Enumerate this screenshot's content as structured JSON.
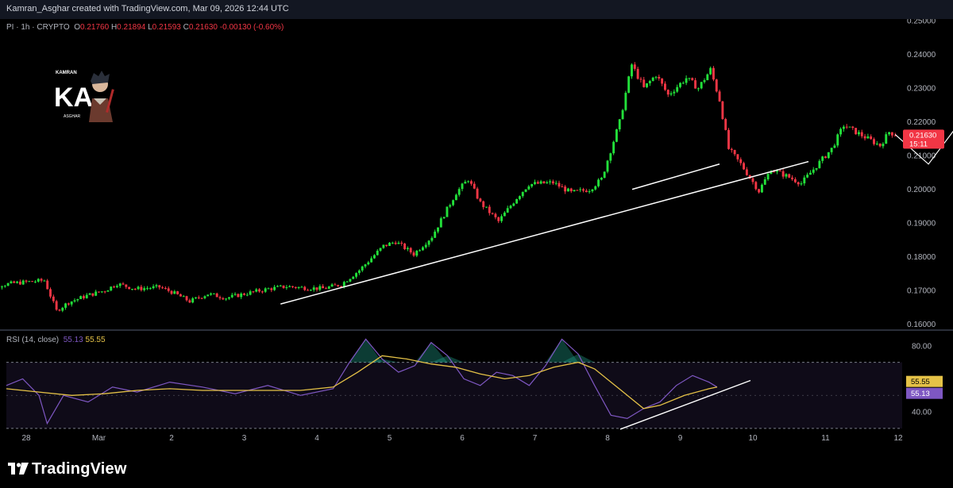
{
  "header": {
    "text": "Kamran_Asghar created with TradingView.com, Mar 09, 2026 12:44 UTC"
  },
  "legend": {
    "symbol": "PI · 1h · CRYPTO",
    "o_label": "O",
    "o_value": "0.21760",
    "h_label": "H",
    "h_value": "0.21894",
    "l_label": "L",
    "l_value": "0.21593",
    "c_label": "C",
    "c_value": "0.21630",
    "change": "-0.00130 (-0.60%)"
  },
  "rsi_legend": {
    "label": "RSI (14, close)",
    "rsi_value": "55.13",
    "ma_value": "55.55"
  },
  "logo": {
    "text": "TradingView"
  },
  "watermark": {
    "top_text": "KAMRAN",
    "mark": "KA",
    "bottom_text": "ASGHAR"
  },
  "colors": {
    "up": "#22e03a",
    "down": "#f23645",
    "rsi": "#7e57c2",
    "rsi_ma": "#e5c247",
    "background": "#000000",
    "drawing": "#ffffff",
    "price_tag": "#f23645"
  },
  "chart_data": [
    {
      "type": "candlestick",
      "title": "PI · 1h · CRYPTO",
      "ylim": [
        0.1585,
        0.2505
      ],
      "yticks": [
        "0.16000",
        "0.17000",
        "0.18000",
        "0.19000",
        "0.20000",
        "0.21000",
        "0.22000",
        "0.23000",
        "0.24000",
        "0.25000"
      ],
      "x_tick_labels": [
        "28",
        "Mar",
        "2",
        "3",
        "4",
        "5",
        "6",
        "7",
        "8",
        "9",
        "10",
        "11",
        "12"
      ],
      "x_tick_dates": [
        "2026-02-28",
        "2026-03-01",
        "2026-03-02",
        "2026-03-03",
        "2026-03-04",
        "2026-03-05",
        "2026-03-06",
        "2026-03-07",
        "2026-03-08",
        "2026-03-09",
        "2026-03-10",
        "2026-03-11",
        "2026-03-12"
      ],
      "current_price": {
        "value": "0.21630",
        "countdown": "15:11"
      },
      "close_path": [
        [
          "2026-02-27 08:00",
          0.1706
        ],
        [
          "2026-02-27 20:00",
          0.1722
        ],
        [
          "2026-02-28 06:00",
          0.173
        ],
        [
          "2026-02-28 10:00",
          0.164
        ],
        [
          "2026-02-28 14:00",
          0.1665
        ],
        [
          "2026-02-28 20:00",
          0.1685
        ],
        [
          "2026-03-01 02:00",
          0.17
        ],
        [
          "2026-03-01 06:00",
          0.172
        ],
        [
          "2026-03-01 12:00",
          0.1705
        ],
        [
          "2026-03-01 20:00",
          0.171
        ],
        [
          "2026-03-02 00:00",
          0.1696
        ],
        [
          "2026-03-02 06:00",
          0.1668
        ],
        [
          "2026-03-02 12:00",
          0.169
        ],
        [
          "2026-03-02 18:00",
          0.1678
        ],
        [
          "2026-03-03 00:00",
          0.169
        ],
        [
          "2026-03-03 08:00",
          0.1705
        ],
        [
          "2026-03-03 14:00",
          0.1712
        ],
        [
          "2026-03-03 20:00",
          0.1708
        ],
        [
          "2026-03-04 02:00",
          0.1706
        ],
        [
          "2026-03-04 08:00",
          0.1718
        ],
        [
          "2026-03-04 14:00",
          0.176
        ],
        [
          "2026-03-04 22:00",
          0.1832
        ],
        [
          "2026-03-05 02:00",
          0.1845
        ],
        [
          "2026-03-05 08:00",
          0.1808
        ],
        [
          "2026-03-05 14:00",
          0.186
        ],
        [
          "2026-03-05 22:00",
          0.199
        ],
        [
          "2026-03-06 02:00",
          0.203
        ],
        [
          "2026-03-06 06:00",
          0.196
        ],
        [
          "2026-03-06 12:00",
          0.1905
        ],
        [
          "2026-03-06 18:00",
          0.1975
        ],
        [
          "2026-03-06 22:00",
          0.2015
        ],
        [
          "2026-03-07 06:00",
          0.202
        ],
        [
          "2026-03-07 12:00",
          0.199
        ],
        [
          "2026-03-07 18:00",
          0.2
        ],
        [
          "2026-03-07 22:00",
          0.203
        ],
        [
          "2026-03-08 04:00",
          0.22
        ],
        [
          "2026-03-08 08:00",
          0.237
        ],
        [
          "2026-03-08 12:00",
          0.23
        ],
        [
          "2026-03-08 16:00",
          0.234
        ],
        [
          "2026-03-08 20:00",
          0.228
        ],
        [
          "2026-03-09 02:00",
          0.233
        ],
        [
          "2026-03-09 06:00",
          0.23
        ],
        [
          "2026-03-09 10:00",
          0.2355
        ],
        [
          "2026-03-09 13:00",
          0.2265
        ],
        [
          "2026-03-09 16:00",
          0.212
        ],
        [
          "2026-03-09 20:00",
          0.2075
        ],
        [
          "2026-03-10 02:00",
          0.1995
        ],
        [
          "2026-03-10 06:00",
          0.206
        ],
        [
          "2026-03-10 11:00",
          0.204
        ],
        [
          "2026-03-10 16:00",
          0.2018
        ],
        [
          "2026-03-10 22:00",
          0.208
        ],
        [
          "2026-03-11 02:00",
          0.212
        ],
        [
          "2026-03-11 06:00",
          0.219
        ],
        [
          "2026-03-11 10:00",
          0.217
        ],
        [
          "2026-03-11 14:00",
          0.215
        ],
        [
          "2026-03-11 18:00",
          0.213
        ],
        [
          "2026-03-11 21:00",
          0.217
        ],
        [
          "2026-03-11 23:00",
          0.2163
        ]
      ],
      "annotations": {
        "trendline": [
          [
            "2026-03-03 12:00",
            0.166
          ],
          [
            "2026-03-11 14:00",
            0.213
          ]
        ],
        "projection_path": [
          [
            "2026-03-11 23:00",
            0.2163
          ],
          [
            "2026-03-12 10:00",
            0.2075
          ],
          [
            "2026-03-12 23:00",
            0.223
          ],
          [
            "2026-03-13 10:00",
            0.2105
          ],
          [
            "2026-03-14 00:00",
            0.2365
          ]
        ]
      }
    },
    {
      "type": "line",
      "title": "RSI (14, close)",
      "ylim": [
        29,
        89
      ],
      "yticks": [
        "40.00",
        "80.00"
      ],
      "bands": [
        70,
        30
      ],
      "series": [
        {
          "name": "RSI",
          "last": "55.13",
          "points": [
            [
              0,
              56
            ],
            [
              2,
              60
            ],
            [
              4,
              50
            ],
            [
              5,
              33
            ],
            [
              7,
              50
            ],
            [
              10,
              46
            ],
            [
              13,
              55
            ],
            [
              16,
              52
            ],
            [
              20,
              58
            ],
            [
              24,
              55
            ],
            [
              28,
              51
            ],
            [
              32,
              56
            ],
            [
              36,
              50
            ],
            [
              40,
              54
            ],
            [
              42,
              70
            ],
            [
              44,
              84
            ],
            [
              46,
              72
            ],
            [
              48,
              64
            ],
            [
              50,
              68
            ],
            [
              52,
              82
            ],
            [
              54,
              74
            ],
            [
              56,
              60
            ],
            [
              58,
              56
            ],
            [
              60,
              64
            ],
            [
              62,
              62
            ],
            [
              64,
              56
            ],
            [
              66,
              68
            ],
            [
              68,
              84
            ],
            [
              70,
              75
            ],
            [
              72,
              56
            ],
            [
              74,
              38
            ],
            [
              76,
              36
            ],
            [
              78,
              42
            ],
            [
              80,
              46
            ],
            [
              82,
              56
            ],
            [
              84,
              62
            ],
            [
              86,
              58
            ],
            [
              87,
              55
            ]
          ]
        },
        {
          "name": "RSI-based MA",
          "last": "55.55",
          "points": [
            [
              0,
              54
            ],
            [
              4,
              52
            ],
            [
              8,
              50
            ],
            [
              12,
              51
            ],
            [
              16,
              53
            ],
            [
              20,
              54
            ],
            [
              24,
              53
            ],
            [
              28,
              53
            ],
            [
              32,
              53
            ],
            [
              36,
              53
            ],
            [
              40,
              55
            ],
            [
              43,
              64
            ],
            [
              46,
              74
            ],
            [
              49,
              72
            ],
            [
              52,
              69
            ],
            [
              55,
              67
            ],
            [
              58,
              63
            ],
            [
              61,
              60
            ],
            [
              64,
              62
            ],
            [
              67,
              67
            ],
            [
              70,
              70
            ],
            [
              72,
              66
            ],
            [
              75,
              54
            ],
            [
              78,
              42
            ],
            [
              80,
              44
            ],
            [
              83,
              50
            ],
            [
              86,
              54
            ],
            [
              87,
              55
            ]
          ]
        }
      ],
      "annotation_trendline": [
        [
          0,
          0
        ],
        [
          1,
          1
        ]
      ]
    }
  ]
}
